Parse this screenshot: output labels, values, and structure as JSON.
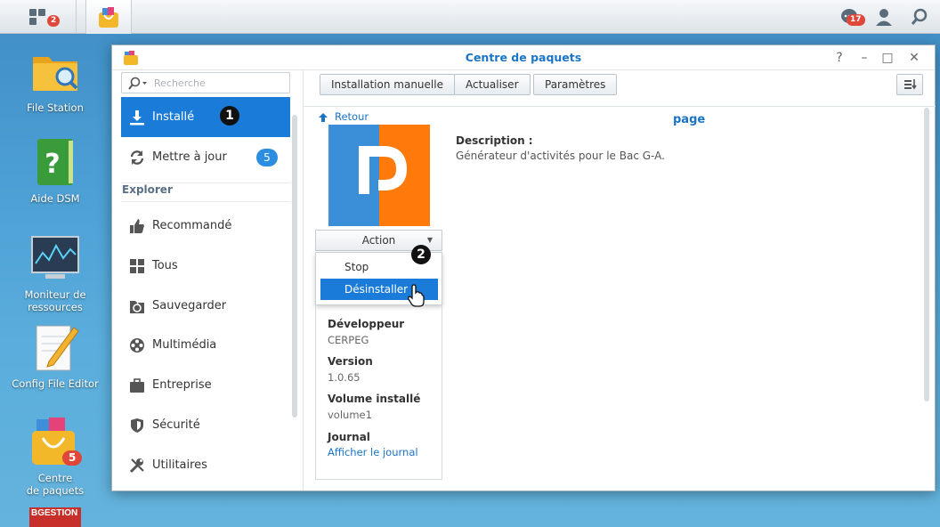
{
  "taskbar": {
    "main_badge": "2",
    "notif_badge": "17"
  },
  "desktop": {
    "icons": [
      {
        "label": "File Station"
      },
      {
        "label": "Aide DSM"
      },
      {
        "label": "Moniteur de\nressources"
      },
      {
        "label": "Config File Editor"
      },
      {
        "label": "Centre\nde paquets",
        "badge": "5"
      },
      {
        "label": "BGESTION"
      }
    ]
  },
  "window": {
    "title": "Centre de paquets",
    "controls": [
      "?",
      "–",
      "□",
      "✕"
    ]
  },
  "sidebar": {
    "search_placeholder": "Recherche",
    "items": [
      {
        "label": "Installé",
        "active": true,
        "icon": "download-icon"
      },
      {
        "label": "Mettre à jour",
        "count": "5",
        "icon": "refresh-icon"
      }
    ],
    "section": "Explorer",
    "explore_items": [
      {
        "label": "Recommandé",
        "icon": "thumbs-up-icon"
      },
      {
        "label": "Tous",
        "icon": "grid-icon"
      },
      {
        "label": "Sauvegarder",
        "icon": "backup-icon"
      },
      {
        "label": "Multimédia",
        "icon": "film-reel-icon"
      },
      {
        "label": "Entreprise",
        "icon": "briefcase-icon"
      },
      {
        "label": "Sécurité",
        "icon": "shield-icon"
      },
      {
        "label": "Utilitaires",
        "icon": "tools-icon"
      }
    ]
  },
  "toolbar": {
    "manual_install": "Installation manuelle",
    "refresh": "Actualiser",
    "settings": "Paramètres"
  },
  "package": {
    "back": "Retour",
    "title": "page",
    "description_label": "Description :",
    "description": "Générateur d'activités pour le Bac G-A.",
    "action_label": "Action",
    "menu": [
      "Stop",
      "Désinstaller"
    ],
    "selected_menu": "Désinstaller",
    "info": [
      {
        "key": "Développeur",
        "value": "CERPEG"
      },
      {
        "key": "Version",
        "value": "1.0.65"
      },
      {
        "key": "Volume installé",
        "value": "volume1"
      },
      {
        "key": "Journal",
        "value": "Afficher le journal",
        "link": true
      }
    ]
  },
  "markers": [
    "1",
    "2"
  ],
  "colors": {
    "accent": "#1a7bd9",
    "title": "#1b75c7",
    "badge": "#e0473b",
    "logo_blue": "#3a8fd8",
    "logo_orange": "#ff7a0a"
  }
}
